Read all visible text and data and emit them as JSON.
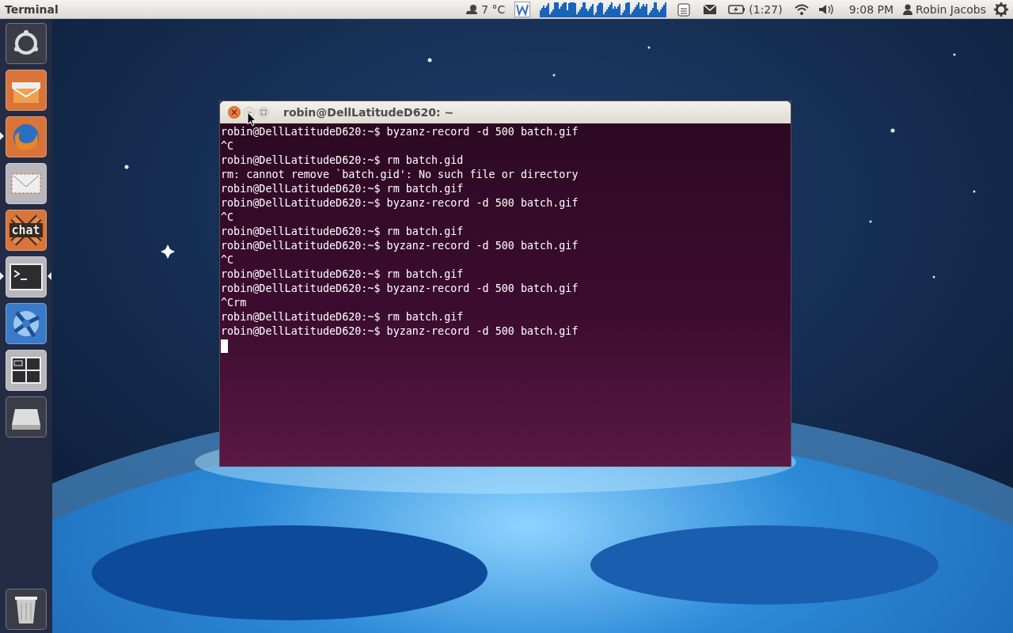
{
  "panel": {
    "app_title": "Terminal",
    "weather": "7 °C",
    "battery": "(1:27)",
    "clock": "9:08 PM",
    "user": "Robin Jacobs"
  },
  "launcher": {
    "items": [
      {
        "kind": "ubuntu",
        "running": false,
        "focused": false
      },
      {
        "kind": "archive",
        "running": false,
        "focused": false
      },
      {
        "kind": "firefox",
        "running": true,
        "focused": false
      },
      {
        "kind": "mail",
        "running": false,
        "focused": false
      },
      {
        "kind": "chat",
        "running": false,
        "focused": false,
        "logo_text": "chat"
      },
      {
        "kind": "terminal",
        "running": true,
        "focused": true
      },
      {
        "kind": "swirl",
        "running": false,
        "focused": false
      },
      {
        "kind": "workspaces",
        "running": false,
        "focused": false
      },
      {
        "kind": "disk",
        "running": false,
        "focused": false
      }
    ],
    "trash": {
      "kind": "trash"
    }
  },
  "terminal": {
    "title": "robin@DellLatitudeD620: ~",
    "lines": [
      "robin@DellLatitudeD620:~$ byzanz-record -d 500 batch.gif",
      "^C",
      "robin@DellLatitudeD620:~$ rm batch.gid",
      "rm: cannot remove `batch.gid': No such file or directory",
      "robin@DellLatitudeD620:~$ rm batch.gif",
      "robin@DellLatitudeD620:~$ byzanz-record -d 500 batch.gif",
      "^C",
      "robin@DellLatitudeD620:~$ rm batch.gif",
      "robin@DellLatitudeD620:~$ byzanz-record -d 500 batch.gif",
      "^C",
      "robin@DellLatitudeD620:~$ rm batch.gif",
      "robin@DellLatitudeD620:~$ byzanz-record -d 500 batch.gif",
      "^Crm",
      "robin@DellLatitudeD620:~$ rm batch.gif",
      "robin@DellLatitudeD620:~$ byzanz-record -d 500 batch.gif"
    ],
    "cursor": true
  }
}
